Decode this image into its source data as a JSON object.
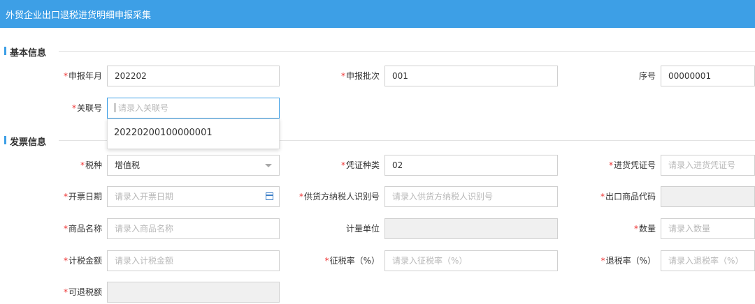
{
  "header": {
    "title": "外贸企业出口退税进货明细申报采集"
  },
  "sections": {
    "basic": "基本信息",
    "invoice": "发票信息"
  },
  "required_mark": "*",
  "fields": {
    "sbny": {
      "label": "申报年月",
      "value": "202202"
    },
    "sbpc": {
      "label": "申报批次",
      "value": "001"
    },
    "xh": {
      "label": "序号",
      "value": "00000001"
    },
    "glh": {
      "label": "关联号",
      "placeholder": "请录入关联号"
    },
    "sz": {
      "label": "税种",
      "value": "增值税"
    },
    "pzzl": {
      "label": "凭证种类",
      "value": "02"
    },
    "jhpzh": {
      "label": "进货凭证号",
      "placeholder": "请录入进货凭证号"
    },
    "kprq": {
      "label": "开票日期",
      "placeholder": "请录入开票日期"
    },
    "ghfsbh": {
      "label": "供货方纳税人识别号",
      "placeholder": "请录入供货方纳税人识别号"
    },
    "ckspdm": {
      "label": "出口商品代码",
      "value": ""
    },
    "spmc": {
      "label": "商品名称",
      "placeholder": "请录入商品名称"
    },
    "jldw": {
      "label": "计量单位",
      "value": ""
    },
    "sl": {
      "label": "数量",
      "placeholder": "请录入数量"
    },
    "jsje": {
      "label": "计税金额",
      "placeholder": "请录入计税金额"
    },
    "zsl": {
      "label": "征税率（%）",
      "placeholder": "请录入征税率（%）"
    },
    "tsl": {
      "label": "退税率（%）",
      "placeholder": "请录入退税率（%）"
    },
    "ktse": {
      "label": "可退税额",
      "value": ""
    }
  },
  "autocomplete": {
    "option": "20220200100000001"
  }
}
